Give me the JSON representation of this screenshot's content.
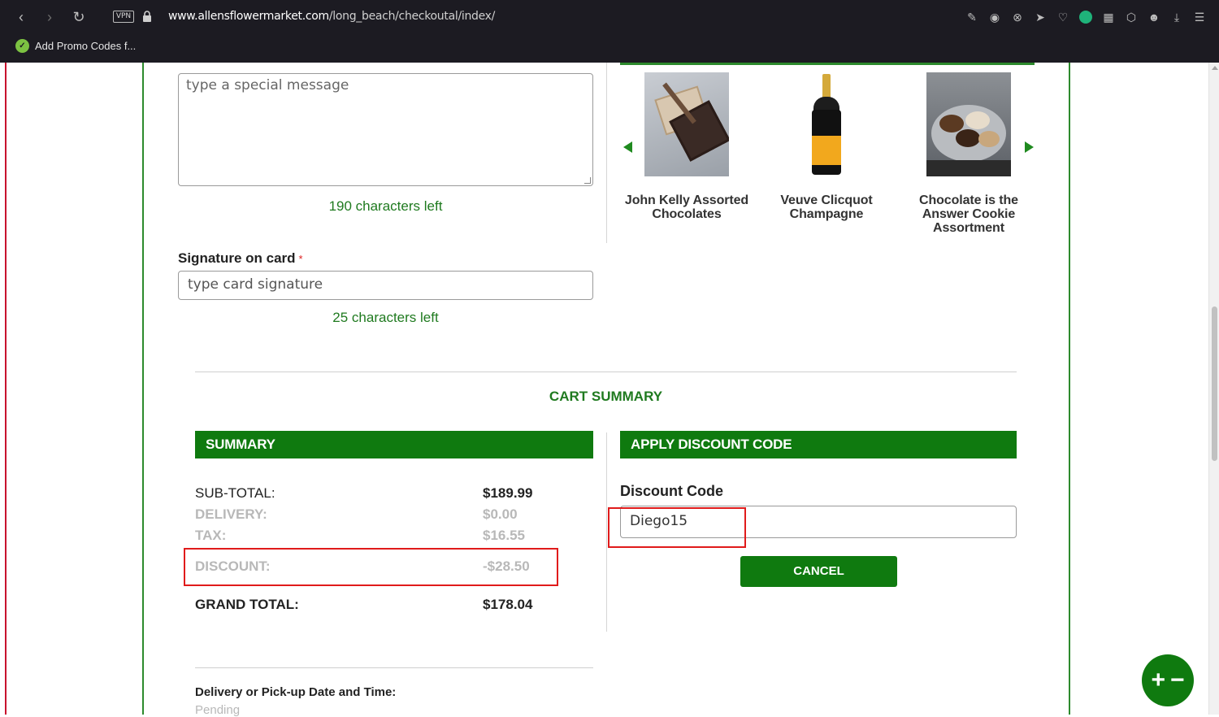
{
  "browser": {
    "url_host": "www.allensflowermarket.com",
    "url_path": "/long_beach/checkoutal/index/",
    "vpn_label": "VPN",
    "bookmark_label": "Add Promo Codes f..."
  },
  "message": {
    "placeholder": "type a special message",
    "chars_left": "190 characters left"
  },
  "signature": {
    "label": "Signature on card",
    "required_mark": "*",
    "placeholder": "type card signature",
    "chars_left": "25 characters left"
  },
  "carousel": {
    "products": [
      {
        "name": "John Kelly Assorted Chocolates",
        "icon": "chocolate-box"
      },
      {
        "name": "Veuve Clicquot Champagne",
        "icon": "champagne-bottle"
      },
      {
        "name": "Chocolate is the Answer Cookie Assortment",
        "icon": "cookie-plate"
      }
    ]
  },
  "cart": {
    "title": "CART SUMMARY",
    "summary_header": "SUMMARY",
    "rows": [
      {
        "label": "SUB-TOTAL:",
        "value": "$189.99"
      },
      {
        "label": "DELIVERY:",
        "value": "$0.00"
      },
      {
        "label": "TAX:",
        "value": "$16.55"
      },
      {
        "label": "DISCOUNT:",
        "value": "-$28.50"
      },
      {
        "label": "GRAND TOTAL:",
        "value": "$178.04"
      }
    ]
  },
  "discount": {
    "header": "APPLY DISCOUNT CODE",
    "label": "Discount Code",
    "value": "Diego15",
    "cancel_label": "CANCEL"
  },
  "delivery": {
    "label": "Delivery or Pick-up Date and Time:",
    "value": "Pending"
  },
  "colors": {
    "brand_green": "#0f7a0f",
    "highlight_red": "#e01b1b"
  }
}
